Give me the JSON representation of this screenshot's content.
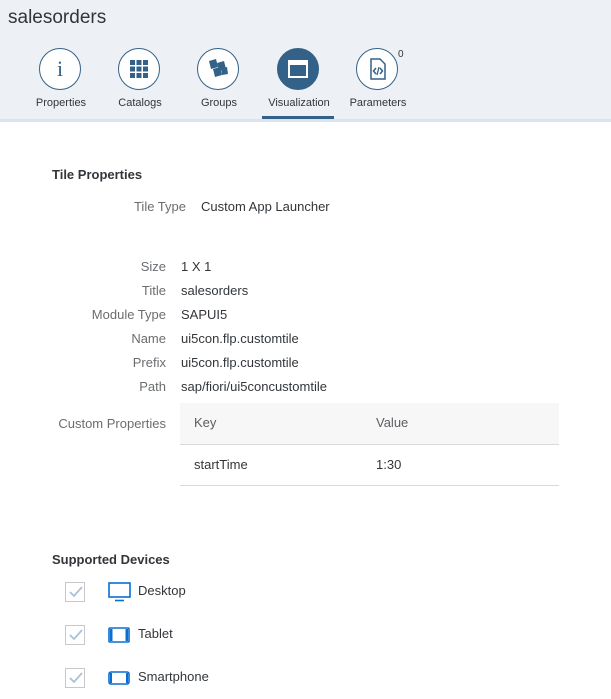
{
  "header": {
    "title": "salesorders"
  },
  "tabs": [
    {
      "label": "Properties",
      "icon": "info-icon",
      "active": false
    },
    {
      "label": "Catalogs",
      "icon": "grid-icon",
      "active": false
    },
    {
      "label": "Groups",
      "icon": "groups-icon",
      "active": false
    },
    {
      "label": "Visualization",
      "icon": "window-icon",
      "active": true
    },
    {
      "label": "Parameters",
      "icon": "code-icon",
      "active": false,
      "badge": "0"
    }
  ],
  "tile_properties": {
    "section_title": "Tile Properties",
    "tile_type_label": "Tile Type",
    "tile_type_value": "Custom App Launcher",
    "size_label": "Size",
    "size_value": "1 X 1",
    "title_label": "Title",
    "title_value": "salesorders",
    "module_type_label": "Module Type",
    "module_type_value": "SAPUI5",
    "name_label": "Name",
    "name_value": "ui5con.flp.customtile",
    "prefix_label": "Prefix",
    "prefix_value": "ui5con.flp.customtile",
    "path_label": "Path",
    "path_value": "sap/fiori/ui5concustomtile",
    "custom_properties_label": "Custom Properties",
    "custom_properties": {
      "columns": [
        "Key",
        "Value"
      ],
      "rows": [
        {
          "key": "startTime",
          "value": "1:30"
        }
      ]
    }
  },
  "supported_devices": {
    "section_title": "Supported Devices",
    "devices": [
      {
        "label": "Desktop",
        "icon": "desktop-icon",
        "checked": true
      },
      {
        "label": "Tablet",
        "icon": "tablet-icon",
        "checked": true
      },
      {
        "label": "Smartphone",
        "icon": "smartphone-icon",
        "checked": true
      }
    ]
  },
  "colors": {
    "accent": "#346187",
    "header_bg": "#edf1f5",
    "device_icon": "#0a6ed1"
  }
}
